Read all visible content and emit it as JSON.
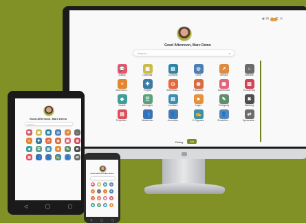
{
  "colors": {
    "background": "#829125",
    "accent": "#7a8d25",
    "toggle": "#f2a23a"
  },
  "desktop": {
    "greeting": "Good Afternoon, Marc Demo",
    "search_placeholder": "Search...",
    "search_icon": "magnifier-icon",
    "top_icons": "■ ✉ ◎ ⊞ ✕",
    "apps": [
      {
        "label": "Dialog",
        "icon": "chat-icon",
        "color": "#e8566b",
        "glyph": "💬"
      },
      {
        "label": "Calendar",
        "icon": "calendar-icon",
        "color": "#c9ba4a",
        "glyph": "▦"
      },
      {
        "label": "Contacts",
        "icon": "contacts-icon",
        "color": "#2b86a6",
        "glyph": "▤"
      },
      {
        "label": "CRM",
        "icon": "crm-icon",
        "color": "#4a7eb6",
        "glyph": "◎"
      },
      {
        "label": "Verkauf",
        "icon": "sales-icon",
        "color": "#e08a41",
        "glyph": "↗"
      },
      {
        "label": "Website",
        "icon": "website-icon",
        "color": "#6b6b6b",
        "glyph": "⌂"
      },
      {
        "label": "Abrechnu...",
        "icon": "invoice-icon",
        "color": "#e3862f",
        "glyph": "≡"
      },
      {
        "label": "Projekt",
        "icon": "project-icon",
        "color": "#3c7aa4",
        "glyph": "✚"
      },
      {
        "label": "Zeiterfass...",
        "icon": "stopwatch-icon",
        "color": "#e5673c",
        "glyph": "◷"
      },
      {
        "label": "Helpdesk",
        "icon": "helpdesk-icon",
        "color": "#d86b41",
        "glyph": "◍"
      },
      {
        "label": "Dashboard",
        "icon": "dashboard-icon",
        "color": "#e0657a",
        "glyph": "▣"
      },
      {
        "label": "E-Learning",
        "icon": "elearning-icon",
        "color": "#cf4456",
        "glyph": "▥"
      },
      {
        "label": "Kunde",
        "icon": "tag-icon",
        "color": "#3f9e9a",
        "glyph": "◆"
      },
      {
        "label": "Umfragen",
        "icon": "survey-icon",
        "color": "#5aa17c",
        "glyph": "☰"
      },
      {
        "label": "Lernkurs",
        "icon": "course-icon",
        "color": "#3c8fb2",
        "glyph": "▤"
      },
      {
        "label": "Lager",
        "icon": "inventory-icon",
        "color": "#e8913d",
        "glyph": "■"
      },
      {
        "label": "Fertigung",
        "icon": "wrench-icon",
        "color": "#5f8f6a",
        "glyph": "✎"
      },
      {
        "label": "Wartung",
        "icon": "maintenance-icon",
        "color": "#4e4e4e",
        "glyph": "✖"
      },
      {
        "label": "Projektzu...",
        "icon": "planning-icon",
        "color": "#db4f5e",
        "glyph": "▤"
      },
      {
        "label": "Mitarbeiter",
        "icon": "employees-icon",
        "color": "#456fa6",
        "glyph": "👥"
      },
      {
        "label": "Anmelden",
        "icon": "attendance-icon",
        "color": "#4c7aa6",
        "glyph": "👤"
      },
      {
        "label": "E-Signatur",
        "icon": "sign-icon",
        "color": "#3f8fa8",
        "glyph": "✍"
      },
      {
        "label": "Einstellen...",
        "icon": "recruit-icon",
        "color": "#5a87b5",
        "glyph": "👤"
      },
      {
        "label": "Spesenabr...",
        "icon": "expenses-icon",
        "color": "#6d6d6d",
        "glyph": "⇄"
      }
    ],
    "theme_label": "Dialog",
    "go_label": "Los"
  },
  "tablet": {
    "greeting": "Good Afternoon, Marc Demo",
    "search_placeholder": "Search..."
  },
  "phone": {
    "greeting": "Good Afternoon, Marc Demo"
  }
}
